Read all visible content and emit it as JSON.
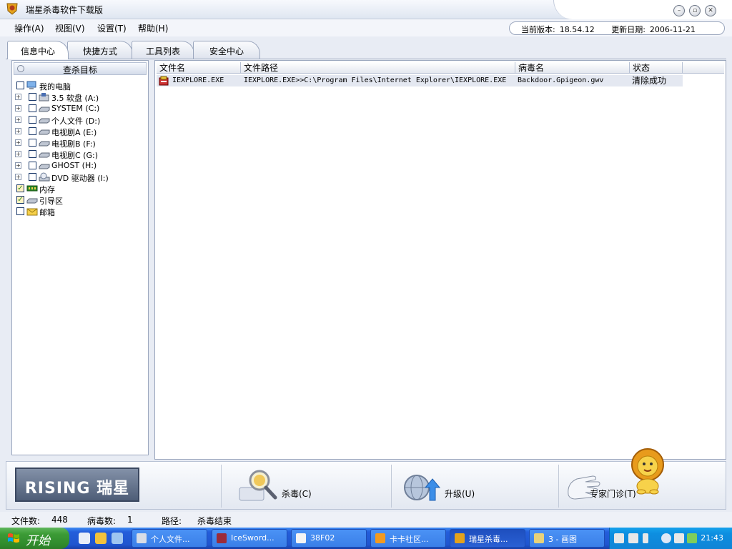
{
  "window": {
    "title": "瑞星杀毒软件下载版",
    "controls": [
      "minimize",
      "restore",
      "close"
    ]
  },
  "menu": {
    "items": [
      "操作(A)",
      "视图(V)",
      "设置(T)",
      "帮助(H)"
    ]
  },
  "version": {
    "current_label": "当前版本:",
    "current": "18.54.12",
    "updated_label": "更新日期:",
    "updated": "2006-11-21"
  },
  "tabs": [
    "信息中心",
    "快捷方式",
    "工具列表",
    "安全中心"
  ],
  "left_panel": {
    "header": "查杀目标",
    "tree": [
      {
        "label": "我的电脑",
        "checked": false,
        "icon": "computer-icon"
      },
      {
        "label": "3.5 软盘 (A:)",
        "checked": false,
        "icon": "floppy-drive-icon"
      },
      {
        "label": "SYSTEM (C:)",
        "checked": false,
        "icon": "hard-drive-icon"
      },
      {
        "label": "个人文件 (D:)",
        "checked": false,
        "icon": "hard-drive-icon"
      },
      {
        "label": "电视剧A (E:)",
        "checked": false,
        "icon": "hard-drive-icon"
      },
      {
        "label": "电视剧B (F:)",
        "checked": false,
        "icon": "hard-drive-icon"
      },
      {
        "label": "电视剧C (G:)",
        "checked": false,
        "icon": "hard-drive-icon"
      },
      {
        "label": "GHOST (H:)",
        "checked": false,
        "icon": "hard-drive-icon"
      },
      {
        "label": "DVD 驱动器 (I:)",
        "checked": false,
        "icon": "dvd-drive-icon"
      },
      {
        "label": "内存",
        "checked": true,
        "icon": "memory-icon"
      },
      {
        "label": "引导区",
        "checked": true,
        "icon": "boot-sector-icon"
      },
      {
        "label": "邮箱",
        "checked": false,
        "icon": "mailbox-icon"
      }
    ]
  },
  "results": {
    "columns": [
      "文件名",
      "文件路径",
      "病毒名",
      "状态"
    ],
    "rows": [
      {
        "file": "IEXPLORE.EXE",
        "path": "IEXPLORE.EXE>>C:\\Program Files\\Internet Explorer\\IEXPLORE.EXE",
        "virus": "Backdoor.Gpigeon.gwv",
        "status": "清除成功",
        "icon": "infected-file-icon"
      }
    ]
  },
  "toolbar": {
    "logo": "RISING 瑞星",
    "scan_label": "杀毒(C)",
    "upgrade_label": "升级(U)",
    "expert_label": "专家门诊(T)",
    "icons": [
      "scan-magnifier-icon",
      "upgrade-globe-icon",
      "expert-hand-icon",
      "lion-mascot-icon"
    ]
  },
  "status": {
    "files_label": "文件数:",
    "files": "448",
    "viruses_label": "病毒数:",
    "viruses": "1",
    "path_label": "路径:",
    "path": "杀毒结束"
  },
  "taskbar": {
    "start": "开始",
    "buttons": [
      "个人文件...",
      "IceSword...",
      "38F02",
      "卡卡社区...",
      "瑞星杀毒...",
      "3 - 画图"
    ],
    "active_index": 4,
    "clock": "21:43"
  }
}
